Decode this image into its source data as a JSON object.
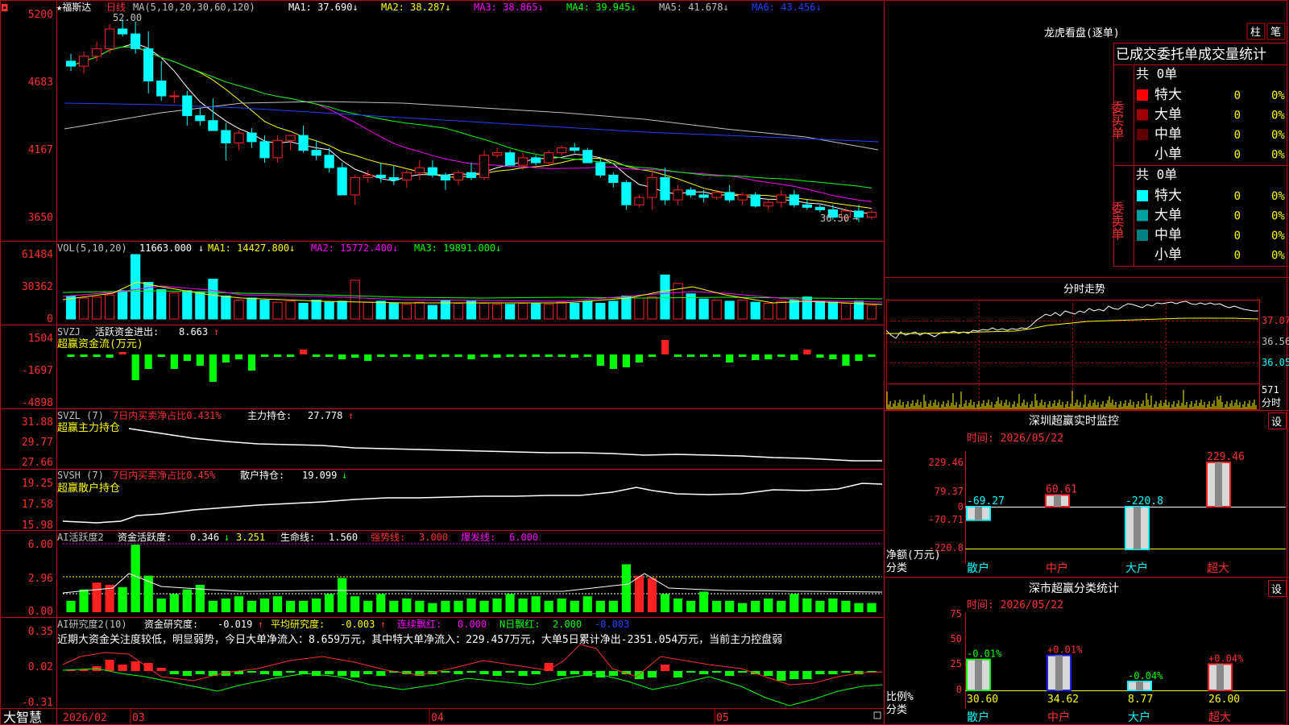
{
  "stock_name": "★福斯达",
  "period": "日线",
  "high_label": "52.00",
  "low_label": "36.50",
  "main_ma": {
    "label": "MA(5,10,20,30,60,120)",
    "values": [
      {
        "name": "MA1:",
        "value": "37.690",
        "arrow": "↓",
        "color": "#ffffff"
      },
      {
        "name": "MA2:",
        "value": "38.287",
        "arrow": "↓",
        "color": "#ffff00"
      },
      {
        "name": "MA3:",
        "value": "38.865",
        "arrow": "↓",
        "color": "#ff00ff"
      },
      {
        "name": "MA4:",
        "value": "39.945",
        "arrow": "↓",
        "color": "#00ff00"
      },
      {
        "name": "MA5:",
        "value": "41.678",
        "arrow": "↓",
        "color": "#c0c0c0"
      },
      {
        "name": "MA6:",
        "value": "43.456",
        "arrow": "↓",
        "color": "#2040ff"
      }
    ]
  },
  "main_axis": [
    "5200",
    "4683",
    "4167",
    "3650"
  ],
  "vol": {
    "label": "VOL(5,10,20)",
    "value": "11663.000",
    "arrow": "↓",
    "ma": [
      {
        "name": "MA1:",
        "value": "14427.800",
        "arrow": "↓",
        "color": "#ffff00"
      },
      {
        "name": "MA2:",
        "value": "15772.400",
        "arrow": "↓",
        "color": "#ff00ff"
      },
      {
        "name": "MA3:",
        "value": "19891.000",
        "arrow": "↓",
        "color": "#00ff00"
      }
    ],
    "axis": [
      "61484",
      "30362",
      "0"
    ]
  },
  "svzj": {
    "label": "SVZJ",
    "name": "活跃资金进出:",
    "value": "8.663",
    "arrow": "↑",
    "sub": "超赢资金流(万元)",
    "axis": [
      "1504",
      "-1697",
      "-4898"
    ]
  },
  "svzl": {
    "label": "SVZL (7)",
    "ratio": "7日内买卖净占比0.431%",
    "name": "主力持仓:",
    "value": "27.778",
    "arrow": "↑",
    "sub": "超赢主力持仓",
    "axis": [
      "31.88",
      "29.77",
      "27.66"
    ]
  },
  "svsh": {
    "label": "SVSH (7)",
    "ratio": "7日内买卖净占比0.45%",
    "name": "散户持仓:",
    "value": "19.099",
    "arrow": "↓",
    "sub": "超赢散户持仓",
    "axis": [
      "19.25",
      "17.58",
      "15.98"
    ]
  },
  "ai1": {
    "label": "AI活跃度2",
    "name": "资金活跃度:",
    "value": "0.346",
    "arrow": "↓",
    "v2": "3.251",
    "life": "生命线:",
    "life_val": "1.560",
    "strong": "强势线:",
    "strong_val": "3.000",
    "burst": "爆发线:",
    "burst_val": "6.000",
    "axis": [
      "6.00",
      "2.96",
      "0.00"
    ]
  },
  "ai2": {
    "label": "AI研究度2(10)",
    "name": "资金研究度:",
    "value": "-0.019",
    "arrow": "↑",
    "avg": "平均研究度:",
    "avg_val": "-0.003",
    "avg_arrow": "↑",
    "red": "连续飘红:",
    "red_val": "0.000",
    "nred": "N日飘红:",
    "nred_val": "2.000",
    "last": "-0.003",
    "axis": [
      "0.35",
      "0.02",
      "-0.31"
    ],
    "note": "近期大资金关注度较低，明显弱势，今日大单净流入：8.659万元，其中特大单净流入：229.457万元，大单5日累计净出-2351.054万元，当前主力控盘弱"
  },
  "date_axis": {
    "brand": "大智慧",
    "labels": [
      "2026/02",
      "03",
      "04",
      "05"
    ]
  },
  "lhb": {
    "title": "龙虎看盘(逐单)",
    "btn1": "柱",
    "btn2": "笔",
    "header": "已成交委托单成交量统计",
    "buy": {
      "side": "委买单",
      "total": "共 0单",
      "rows": [
        {
          "label": "特大",
          "count": "0",
          "pct": "0%",
          "color": "#ff0000"
        },
        {
          "label": "大单",
          "count": "0",
          "pct": "0%",
          "color": "#a00000"
        },
        {
          "label": "中单",
          "count": "0",
          "pct": "0%",
          "color": "#600000"
        },
        {
          "label": "小单",
          "count": "0",
          "pct": "0%",
          "color": "#000000"
        }
      ]
    },
    "sell": {
      "side": "委卖单",
      "total": "共 0单",
      "rows": [
        {
          "label": "特大",
          "count": "0",
          "pct": "0%",
          "color": "#00ffff"
        },
        {
          "label": "大单",
          "count": "0",
          "pct": "0%",
          "color": "#00a0a0"
        },
        {
          "label": "中单",
          "count": "0",
          "pct": "0%",
          "color": "#008080"
        },
        {
          "label": "小单",
          "count": "0",
          "pct": "0%",
          "color": "#000000"
        }
      ]
    }
  },
  "fenshi": {
    "title": "分时走势",
    "axis": [
      "37.07",
      "36.56",
      "36.05",
      "571"
    ],
    "unit": "分时"
  },
  "monitor": {
    "title": "深圳超赢实时监控",
    "btn": "设",
    "time": "时间: 2026/05/22",
    "axis": [
      "229.46",
      "79.37",
      "0",
      "-70.71",
      "-220.8"
    ],
    "ylabel": "净额(万元)",
    "xlabel": "分类",
    "bars": [
      {
        "cat": "散户",
        "value": -69.27,
        "label": "-69.27"
      },
      {
        "cat": "中户",
        "value": 60.61,
        "label": "60.61"
      },
      {
        "cat": "大户",
        "value": -220.8,
        "label": "-220.8"
      },
      {
        "cat": "超大",
        "value": 229.46,
        "label": "229.46"
      }
    ]
  },
  "classify": {
    "title": "深市超赢分类统计",
    "btn": "设",
    "time": "时间: 2026/05/22",
    "axis": [
      "75",
      "50",
      "25",
      "0"
    ],
    "ylabel": "比例%",
    "xlabel": "分类",
    "bars": [
      {
        "cat": "散户",
        "value": 30.6,
        "label": "30.60",
        "delta": "-0.01%"
      },
      {
        "cat": "中户",
        "value": 34.62,
        "label": "34.62",
        "delta": "+0.01%"
      },
      {
        "cat": "大户",
        "value": 8.77,
        "label": "8.77",
        "delta": "-0.04%"
      },
      {
        "cat": "超大",
        "value": 26.0,
        "label": "26.00",
        "delta": "+0.04%"
      }
    ]
  },
  "colors": {
    "up": "#ff2020",
    "down": "#00ffff",
    "frame": "#c00000",
    "text_red": "#ff3030",
    "yellow": "#ffff00",
    "green": "#00ff00"
  },
  "chart_data": {
    "type": "candlestick",
    "dates": [
      "2026/02",
      "03",
      "04",
      "05"
    ],
    "ohlc": [
      [
        48.6,
        49.2,
        47.8,
        48.2
      ],
      [
        48.2,
        49.4,
        47.6,
        49.0
      ],
      [
        49.0,
        50.2,
        48.6,
        49.6
      ],
      [
        49.6,
        51.6,
        49.2,
        51.2
      ],
      [
        51.2,
        52.0,
        50.6,
        50.8
      ],
      [
        50.8,
        51.8,
        49.2,
        49.6
      ],
      [
        49.6,
        51.0,
        46.0,
        47.0
      ],
      [
        47.0,
        48.6,
        45.4,
        45.8
      ],
      [
        45.8,
        46.2,
        45.2,
        45.8
      ],
      [
        45.8,
        46.2,
        43.4,
        44.2
      ],
      [
        44.2,
        44.8,
        43.4,
        43.8
      ],
      [
        43.8,
        45.6,
        43.4,
        43.0
      ],
      [
        43.0,
        43.6,
        40.6,
        42.0
      ],
      [
        42.0,
        43.0,
        41.4,
        42.8
      ],
      [
        42.8,
        43.2,
        41.6,
        42.1
      ],
      [
        42.1,
        42.6,
        40.4,
        40.8
      ],
      [
        40.8,
        42.6,
        40.4,
        42.2
      ],
      [
        42.2,
        42.6,
        41.4,
        42.6
      ],
      [
        42.6,
        43.4,
        41.2,
        41.4
      ],
      [
        41.4,
        42.2,
        40.6,
        41.0
      ],
      [
        41.0,
        41.6,
        39.6,
        40.0
      ],
      [
        40.0,
        40.4,
        38.2,
        37.8
      ],
      [
        37.8,
        39.4,
        37.0,
        39.2
      ],
      [
        39.2,
        39.8,
        38.8,
        39.4
      ],
      [
        39.4,
        40.4,
        38.8,
        39.2
      ],
      [
        39.2,
        40.2,
        38.6,
        39.0
      ],
      [
        39.0,
        39.8,
        38.4,
        39.6
      ],
      [
        39.6,
        40.6,
        39.0,
        40.0
      ],
      [
        40.0,
        40.6,
        39.2,
        39.4
      ],
      [
        39.4,
        39.6,
        38.2,
        39.0
      ],
      [
        39.0,
        39.8,
        38.6,
        39.6
      ],
      [
        39.6,
        40.4,
        39.0,
        39.2
      ],
      [
        39.2,
        41.4,
        39.0,
        41.0
      ],
      [
        41.0,
        41.6,
        40.8,
        41.2
      ],
      [
        41.2,
        41.4,
        40.2,
        40.2
      ],
      [
        40.2,
        41.2,
        39.8,
        40.8
      ],
      [
        40.8,
        41.0,
        40.2,
        40.4
      ],
      [
        40.4,
        41.4,
        40.2,
        41.2
      ],
      [
        41.2,
        41.8,
        41.0,
        41.6
      ],
      [
        41.6,
        42.0,
        41.2,
        41.4
      ],
      [
        41.4,
        41.6,
        40.4,
        40.4
      ],
      [
        40.4,
        40.8,
        39.2,
        39.4
      ],
      [
        39.4,
        39.6,
        38.4,
        38.8
      ],
      [
        38.8,
        39.0,
        36.6,
        37.0
      ],
      [
        37.0,
        37.8,
        36.8,
        37.6
      ],
      [
        37.6,
        39.8,
        36.6,
        39.2
      ],
      [
        39.2,
        40.0,
        37.0,
        37.4
      ],
      [
        37.4,
        38.6,
        37.0,
        38.2
      ],
      [
        38.2,
        38.4,
        37.6,
        37.8
      ],
      [
        37.8,
        38.2,
        37.2,
        37.6
      ],
      [
        37.6,
        38.2,
        37.4,
        38.0
      ],
      [
        38.0,
        38.6,
        37.2,
        37.4
      ],
      [
        37.4,
        38.0,
        37.0,
        37.8
      ],
      [
        37.8,
        38.0,
        36.8,
        36.9
      ],
      [
        36.9,
        37.4,
        36.6,
        37.2
      ],
      [
        37.2,
        38.2,
        36.8,
        37.8
      ],
      [
        37.8,
        38.2,
        36.8,
        37.0
      ],
      [
        37.0,
        37.4,
        36.6,
        36.8
      ],
      [
        36.8,
        37.0,
        36.4,
        36.6
      ],
      [
        36.6,
        37.0,
        35.8,
        36.0
      ],
      [
        36.0,
        36.8,
        35.6,
        36.5
      ],
      [
        36.5,
        37.0,
        35.6,
        36.0
      ],
      [
        36.0,
        36.6,
        35.8,
        36.4
      ]
    ],
    "volume": [
      22000,
      20000,
      21000,
      23000,
      27000,
      61484,
      35000,
      28000,
      25000,
      27000,
      26000,
      38000,
      22000,
      18000,
      20000,
      18000,
      16000,
      17000,
      15000,
      18000,
      16000,
      17000,
      37000,
      16000,
      17000,
      15000,
      14000,
      16000,
      13000,
      18000,
      15000,
      17000,
      15000,
      14000,
      14000,
      15000,
      15000,
      14000,
      16000,
      15000,
      17000,
      15000,
      17000,
      22000,
      20000,
      21000,
      42000,
      34000,
      24000,
      19000,
      18000,
      17000,
      18000,
      16000,
      15000,
      17000,
      18000,
      21000,
      17000,
      16000,
      15000,
      17000,
      13000
    ],
    "ylim": [
      35.0,
      52.5
    ]
  }
}
